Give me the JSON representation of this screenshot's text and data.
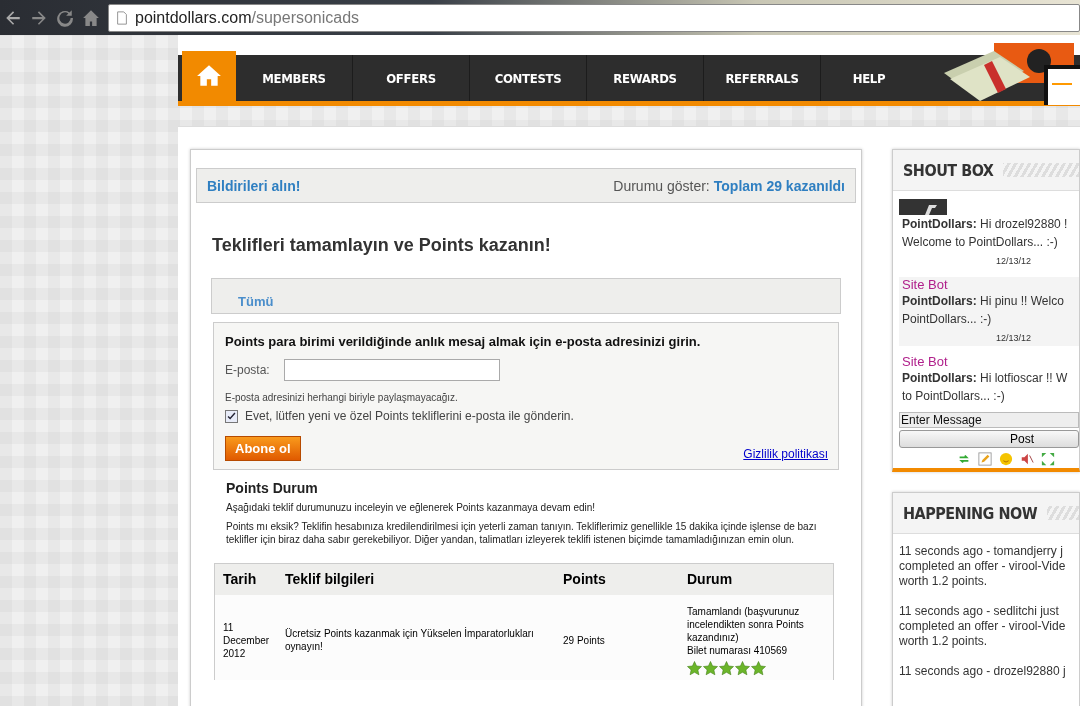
{
  "browser": {
    "url_host": "pointdollars.com",
    "url_path": "/supersonicads"
  },
  "nav": {
    "items": [
      {
        "kind": "home",
        "selected": true
      },
      {
        "kind": "link",
        "label": "MEMBERS",
        "selected": false
      },
      {
        "kind": "link",
        "label": "OFFERS",
        "selected": false
      },
      {
        "kind": "link",
        "label": "CONTESTS",
        "selected": false
      },
      {
        "kind": "link",
        "label": "REWARDS",
        "selected": false
      },
      {
        "kind": "link",
        "label": "REFERRALS",
        "selected": false
      },
      {
        "kind": "link",
        "label": "HELP",
        "selected": false
      }
    ]
  },
  "notice_bar": {
    "link": "Bildirileri alın!",
    "status_label": "Durumu göster:",
    "status_value": "Toplam 29 kazanıldı"
  },
  "heading": "Teklifleri tamamlayın ve Points kazanın!",
  "filter_tabs": [
    {
      "label": "Tümü",
      "selected": true
    }
  ],
  "subscribe": {
    "title": "Points para birimi verildiğinde anlık mesaj almak için e-posta adresinizi girin.",
    "email_label": "E-posta:",
    "privacy_note": "E-posta adresinizi herhangi biriyle paylaşmayacağız.",
    "opt_in": {
      "label": "Evet, lütfen yeni ve özel Points tekliflerini e-posta ile gönderin.",
      "checked": true
    },
    "button": "Abone ol",
    "privacy_link": "Gizlilik politikası"
  },
  "status_section": {
    "title": "Points Durum",
    "intro": "Aşağıdaki teklif durumunuzu inceleyin ve eğlenerek Points kazanmaya devam edin!",
    "note": "Points mı eksik? Teklifin hesabınıza kredilendirilmesi için yeterli zaman tanıyın. Tekliflerimiz genellikle 15 dakika içinde işlense de bazı teklifler için biraz daha sabır gerekebiliyor. Diğer yandan, talimatları izleyerek teklifi istenen biçimde tamamladığınızan emin olun."
  },
  "table": {
    "columns": [
      "Tarih",
      "Teklif bilgileri",
      "Points",
      "Durum"
    ],
    "rows": [
      {
        "date": "11 December 2012",
        "offer": "Ücretsiz Points kazanmak için Yükselen İmparatorlukları oynayın!",
        "points": "29 Points",
        "status": "Tamamlandı (başvurunuz incelendikten sonra Points kazandınız)",
        "ticket": "Bilet numarası 410569",
        "stars": 5
      }
    ]
  },
  "shout_box": {
    "title": "SHOUT BOX",
    "messages": [
      {
        "lines": [
          "**PointDollars:** Hi drozel92880 !",
          "Welcome to PointDollars... :-)"
        ],
        "time": "12/13/12"
      },
      {
        "author": "Site Bot",
        "lines": [
          "**PointDollars:** Hi pinu !! Welco",
          "PointDollars... :-)"
        ],
        "time": "12/13/12"
      },
      {
        "author": "Site Bot",
        "lines": [
          "**PointDollars:** Hi lotfioscar !! W",
          "to PointDollars... :-)"
        ]
      }
    ],
    "input": {
      "placeholder": "Enter Message"
    },
    "button": "Post"
  },
  "happening_now": {
    "title": "HAPPENING NOW",
    "items": [
      {
        "lines": [
          "11 seconds ago - tomandjerry j",
          "completed an offer - virool-Vide",
          "worth 1.2 points."
        ]
      },
      {
        "lines": [
          "11 seconds ago - sedlitchi just",
          "completed an offer - virool-Vide",
          "worth 1.2 points."
        ]
      },
      {
        "lines": [
          "11 seconds ago - drozel92880 j"
        ]
      }
    ]
  }
}
